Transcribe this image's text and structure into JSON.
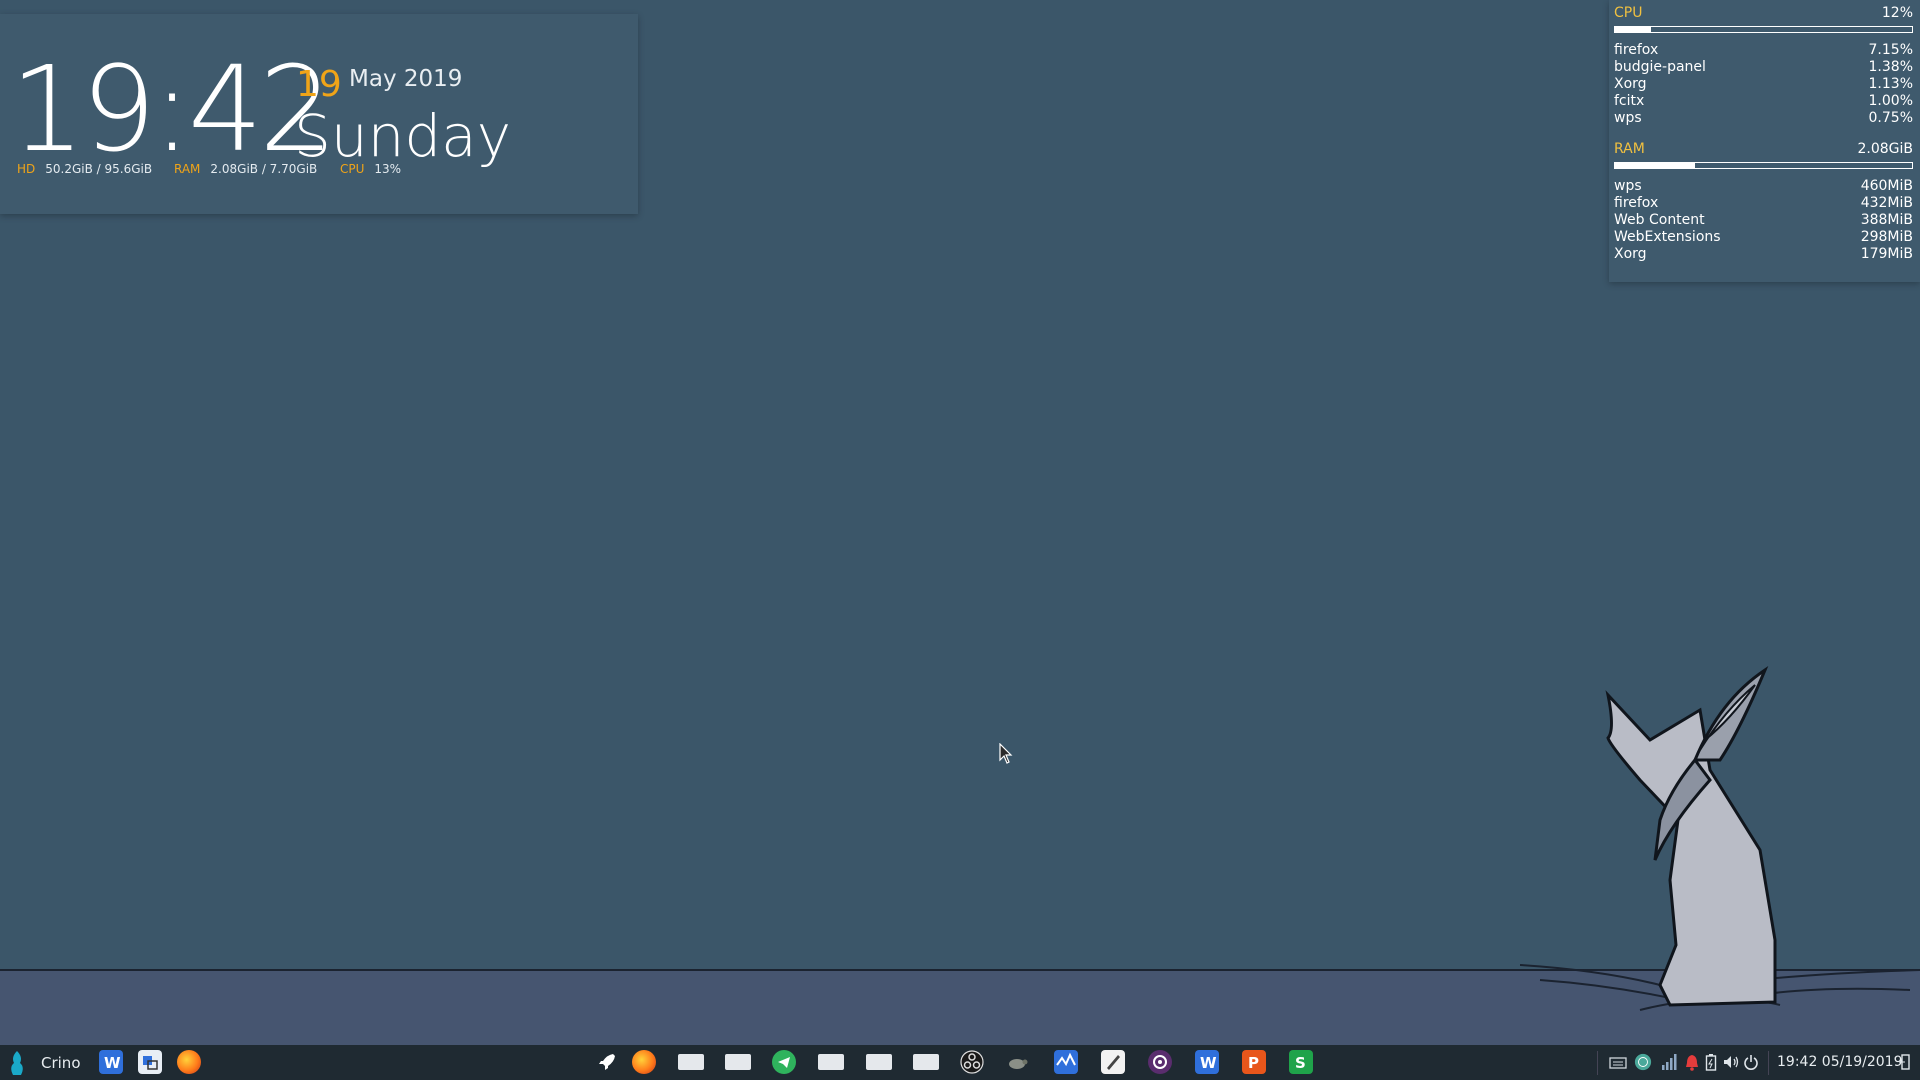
{
  "clock": {
    "time": "19:42",
    "day": "19",
    "month_year": "May 2019",
    "weekday": "Sunday",
    "stats": [
      {
        "label": "HD",
        "value": "50.2GiB / 95.6GiB"
      },
      {
        "label": "RAM",
        "value": "2.08GiB / 7.70GiB"
      },
      {
        "label": "CPU",
        "value": "13%"
      }
    ]
  },
  "conky": {
    "cpu": {
      "label": "CPU",
      "total": "12%",
      "fraction": 0.12,
      "processes": [
        {
          "name": "firefox",
          "value": "7.15%"
        },
        {
          "name": "budgie-panel",
          "value": "1.38%"
        },
        {
          "name": "Xorg",
          "value": "1.13%"
        },
        {
          "name": "fcitx",
          "value": "1.00%"
        },
        {
          "name": "wps",
          "value": "0.75%"
        }
      ]
    },
    "ram": {
      "label": "RAM",
      "total": "2.08GiB",
      "fraction": 0.27,
      "processes": [
        {
          "name": "wps",
          "value": "460MiB"
        },
        {
          "name": "firefox",
          "value": "432MiB"
        },
        {
          "name": "Web Content",
          "value": "388MiB"
        },
        {
          "name": "WebExtensions",
          "value": "298MiB"
        },
        {
          "name": "Xorg",
          "value": "179MiB"
        }
      ]
    }
  },
  "taskbar": {
    "menu_label": "Crino",
    "pinned_left": [
      "wps-writer-icon",
      "screenshot-tool-icon",
      "firefox-icon"
    ],
    "center_apps": [
      "rocket-launcher-icon",
      "firefox-icon",
      "window-placeholder-icon",
      "window-placeholder-icon",
      "telegram-icon",
      "window-placeholder-icon",
      "window-placeholder-icon",
      "window-placeholder-icon",
      "obs-studio-icon",
      "tortoise-icon",
      "system-monitor-icon",
      "text-editor-icon",
      "media-player-icon",
      "wps-writer-icon",
      "wps-presentation-icon",
      "wps-spreadsheet-icon"
    ],
    "tray": [
      "keyboard-icon",
      "network-globe-icon",
      "signal-icon",
      "notification-bell-icon",
      "battery-icon",
      "volume-icon",
      "power-icon"
    ],
    "clock": "19:42 05/19/2019",
    "colors": {
      "bg": "#1f2a32",
      "firefox": "#ff7b1a",
      "telegram": "#2fb35d",
      "wps_blue": "#2f6fdb",
      "wps_orange": "#e8561b",
      "wps_green": "#1fa34a"
    }
  }
}
